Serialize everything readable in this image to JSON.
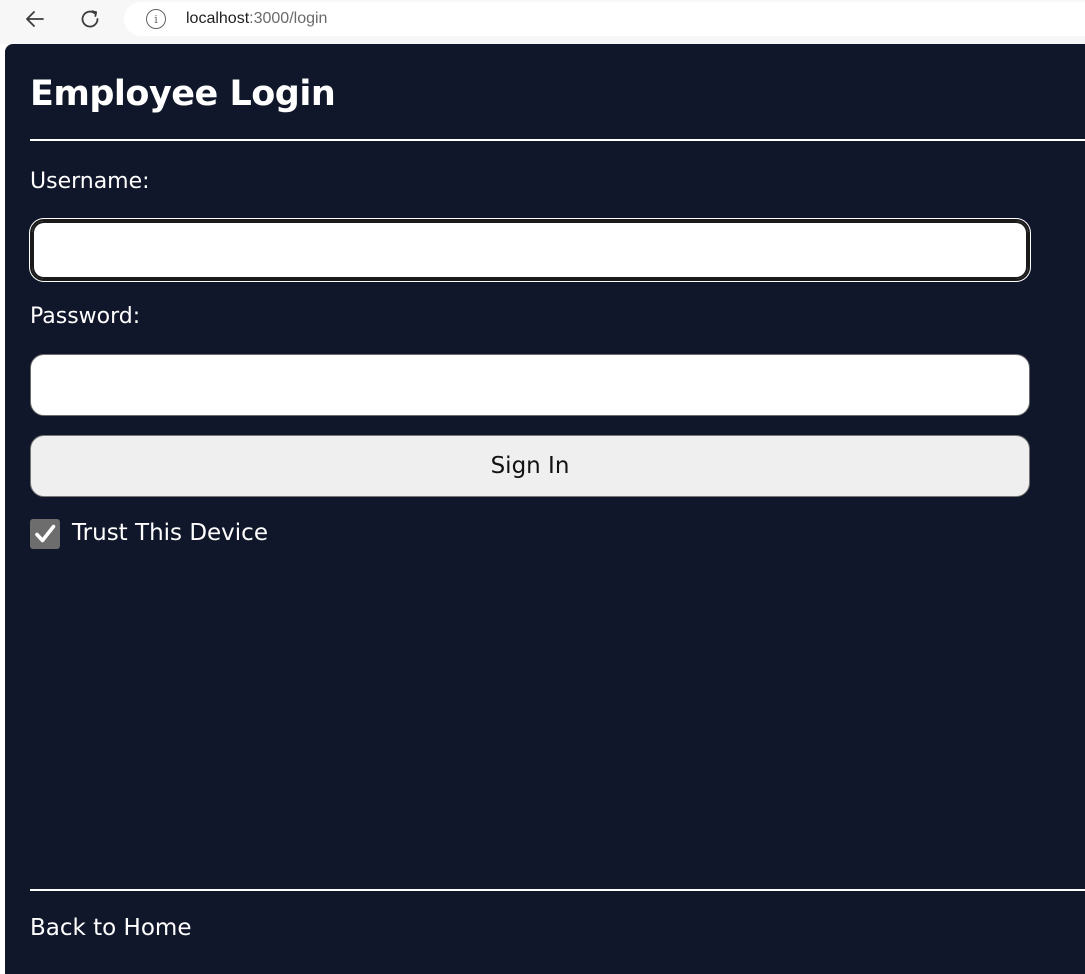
{
  "browser": {
    "url_host": "localhost",
    "url_path": ":3000/login",
    "info_icon": "i"
  },
  "login": {
    "title": "Employee Login",
    "username_label": "Username:",
    "username_value": "",
    "password_label": "Password:",
    "password_value": "",
    "sign_in_label": "Sign In",
    "trust_device_label": "Trust This Device",
    "trust_device_checked": true,
    "back_link": "Back to Home"
  },
  "colors": {
    "page_background": "#10172a",
    "chrome_background": "#f7f7f7",
    "text": "#ffffff",
    "button_background": "#efefef",
    "checkbox_background": "#6d6d6d"
  },
  "icons": {
    "back": "arrow-left-icon",
    "reload": "reload-icon",
    "info": "info-icon",
    "check": "checkmark-icon"
  }
}
